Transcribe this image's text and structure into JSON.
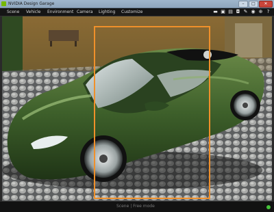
{
  "window": {
    "title": "NVIDIA Design Garage",
    "buttons": [
      "–",
      "□",
      "✕"
    ]
  },
  "menu": {
    "items": [
      "Scene",
      "Vehicle",
      "Environment",
      "Camera",
      "Lighting",
      "Customize"
    ]
  },
  "toolbar": {
    "icons": [
      "folder-icon",
      "save-icon",
      "export-icon",
      "camera-icon",
      "brush-icon",
      "eye-icon",
      "target-icon",
      "help-icon"
    ],
    "glyphs": [
      "▬",
      "▣",
      "▤",
      "◘",
      "✎",
      "◉",
      "⊕",
      "?"
    ]
  },
  "status": {
    "text": "Scene | Free mode"
  },
  "colors": {
    "accent": "#f0902a",
    "car": "#3d5f2a",
    "status_dot": "#45c23a"
  }
}
